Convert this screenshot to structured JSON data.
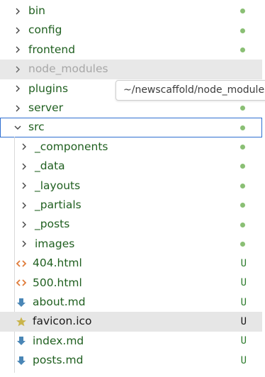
{
  "explorer": {
    "items": [
      {
        "label": "bin",
        "type": "folder",
        "status": "dot"
      },
      {
        "label": "config",
        "type": "folder",
        "status": "dot"
      },
      {
        "label": "frontend",
        "type": "folder",
        "status": "dot"
      },
      {
        "label": "node_modules",
        "type": "folder",
        "status": "",
        "dimmed": true
      },
      {
        "label": "plugins",
        "type": "folder",
        "status": "dot"
      },
      {
        "label": "server",
        "type": "folder",
        "status": "dot"
      },
      {
        "label": "src",
        "type": "folder-open",
        "status": "dot"
      },
      {
        "label": "_components",
        "type": "folder",
        "status": "dot"
      },
      {
        "label": "_data",
        "type": "folder",
        "status": "dot"
      },
      {
        "label": "_layouts",
        "type": "folder",
        "status": "dot"
      },
      {
        "label": "_partials",
        "type": "folder",
        "status": "dot"
      },
      {
        "label": "_posts",
        "type": "folder",
        "status": "dot"
      },
      {
        "label": "images",
        "type": "folder",
        "status": "dot"
      },
      {
        "label": "404.html",
        "type": "html",
        "status": "U"
      },
      {
        "label": "500.html",
        "type": "html",
        "status": "U"
      },
      {
        "label": "about.md",
        "type": "markdown",
        "status": "U"
      },
      {
        "label": "favicon.ico",
        "type": "ico",
        "status": "U"
      },
      {
        "label": "index.md",
        "type": "markdown",
        "status": "U"
      },
      {
        "label": "posts.md",
        "type": "markdown",
        "status": "U"
      }
    ],
    "tooltip": "~/newscaffold/node_modules"
  },
  "colors": {
    "label_green": "#1f5f1f",
    "status_dot": "#8abf74",
    "selection_border": "#2f6fd1",
    "hover_bg": "#e8e8e8",
    "html_icon": "#e07b39",
    "markdown_icon": "#4a86b6",
    "star_icon": "#c9b44b"
  },
  "icons": {
    "chevron_right": "chevron-right-icon",
    "chevron_down": "chevron-down-icon",
    "html": "code-brackets-icon",
    "markdown": "download-arrow-icon",
    "ico": "star-icon"
  }
}
